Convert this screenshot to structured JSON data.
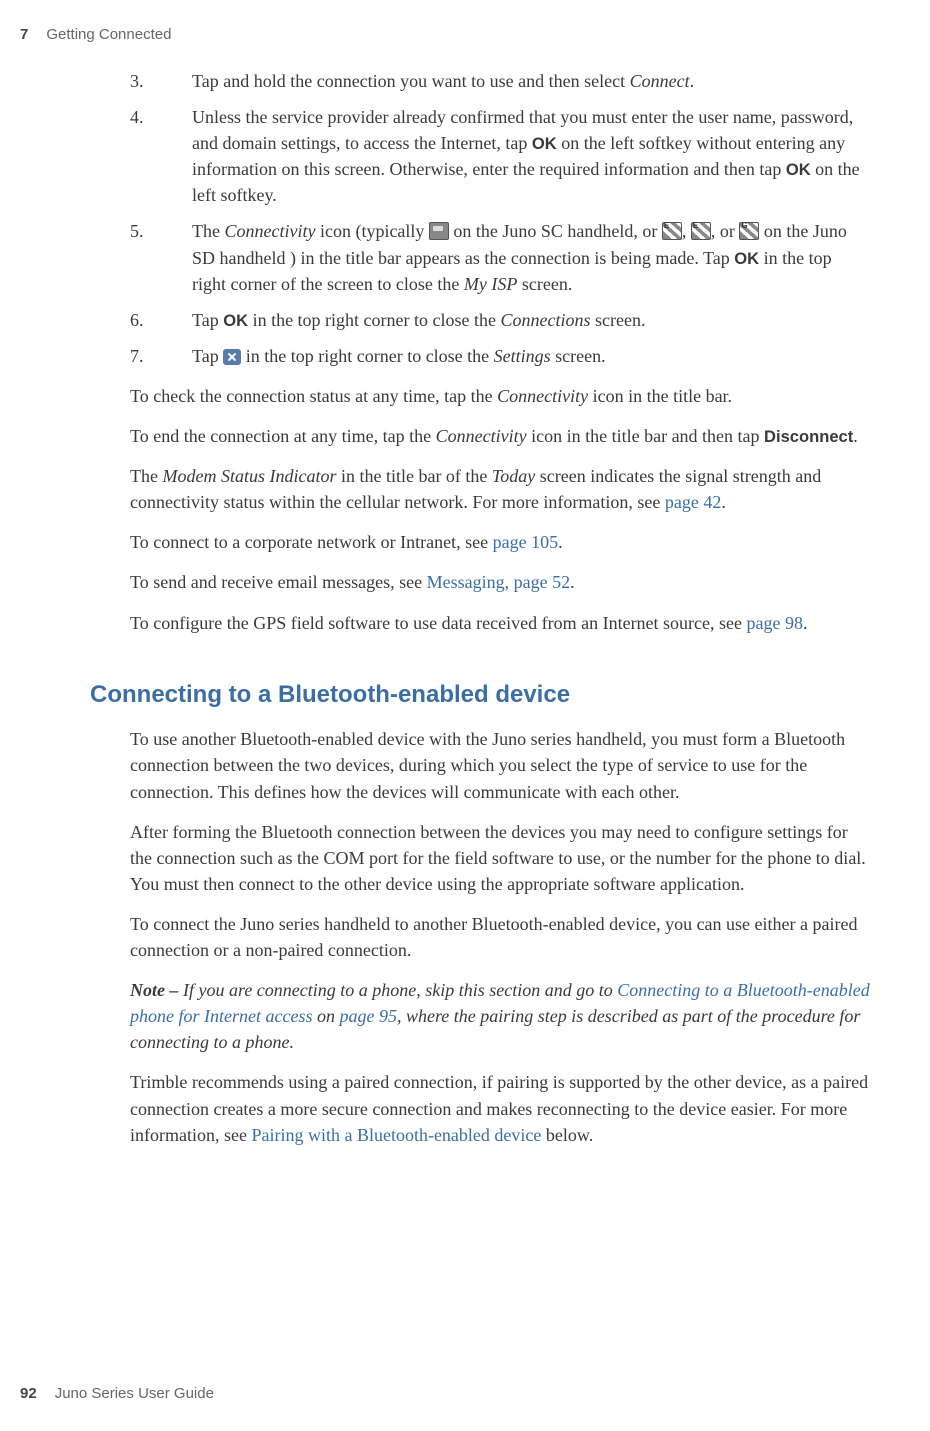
{
  "header": {
    "chapter": "7",
    "title": "Getting Connected"
  },
  "footer": {
    "page": "92",
    "title": "Juno Series User Guide"
  },
  "steps": {
    "s3": {
      "num": "3.",
      "text_a": "Tap and hold the connection you want to use and then select ",
      "italic_a": "Connect",
      "text_b": "."
    },
    "s4": {
      "num": "4.",
      "text_a": "Unless the service provider already confirmed that you must enter the user name, password, and domain settings, to access the Internet, tap ",
      "bold_a": "OK",
      "text_b": " on the left softkey without entering any information on this screen. Otherwise, enter the required information and then tap ",
      "bold_b": "OK",
      "text_c": " on the left softkey."
    },
    "s5": {
      "num": "5.",
      "text_a": "The ",
      "italic_a": "Connectivity",
      "text_b": " icon (typically ",
      "text_c": " on the Juno SC handheld, or ",
      "sep1": ", ",
      "sep2": ", or ",
      "text_d": " on the Juno SD handheld ) in the title bar appears as the connection is being made. Tap ",
      "bold_a": "OK",
      "text_e": " in the top right corner of the screen to close the ",
      "italic_b": "My ISP",
      "text_f": " screen."
    },
    "s6": {
      "num": "6.",
      "text_a": "Tap ",
      "bold_a": "OK",
      "text_b": " in the top right corner to close the ",
      "italic_a": "Connections",
      "text_c": " screen."
    },
    "s7": {
      "num": "7.",
      "text_a": "Tap ",
      "text_b": " in the top right corner to close the ",
      "italic_a": "Settings",
      "text_c": " screen."
    }
  },
  "paras": {
    "p1": {
      "a": "To check the connection status at any time, tap the ",
      "i": "Connectivity",
      "b": " icon in the title bar."
    },
    "p2": {
      "a": "To end the connection at any time, tap the ",
      "i": "Connectivity",
      "b": " icon in the title bar and then tap ",
      "bold": "Disconnect",
      "c": "."
    },
    "p3": {
      "a": "The ",
      "i1": "Modem Status Indicator",
      "b": " in the title bar of the ",
      "i2": "Today",
      "c": " screen indicates the signal strength and connectivity status within the cellular network. For more information, see ",
      "link": "page 42",
      "d": "."
    },
    "p4": {
      "a": "To connect to a corporate network or Intranet, see ",
      "link": "page 105",
      "b": "."
    },
    "p5": {
      "a": "To send and receive email messages, see ",
      "link": "Messaging, page 52",
      "b": "."
    },
    "p6": {
      "a": "To configure the GPS field software to use data received from an Internet source, see ",
      "link": "page 98",
      "b": "."
    }
  },
  "h2": "Connecting to a Bluetooth-enabled device",
  "bt": {
    "p1": "To use another Bluetooth-enabled device with the Juno series handheld, you must form a Bluetooth connection between the two devices, during which you  select the type of service to use for the connection.  This defines how the devices will communicate with each other.",
    "p2": "After forming the Bluetooth connection between the devices you may need to configure settings for the connection such as the COM port for the field software to use, or the number for the phone to dial. You must then connect to the other device using the appropriate software application.",
    "p3": "To connect the Juno series handheld to another Bluetooth-enabled device, you can use either a paired connection or a non-paired connection.",
    "note": {
      "lead": "Note – ",
      "a": "If you are connecting to a phone, skip this section and go to ",
      "link": "Connecting to a Bluetooth-enabled phone for Internet access",
      "b": " on ",
      "link2": "page 95",
      "c": ", where the pairing step is described as part of the procedure for connecting to a phone."
    },
    "p4": {
      "a": "Trimble recommends using a paired connection, if pairing is supported by the other device, as a paired connection creates a more secure connection and makes reconnecting to the device easier. For more information, see ",
      "link": "Pairing with a Bluetooth-enabled device",
      "b": " below."
    }
  }
}
